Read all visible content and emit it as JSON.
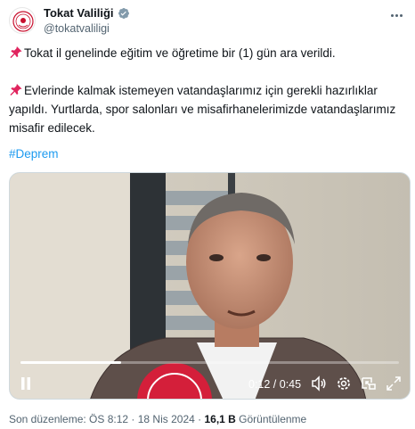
{
  "account": {
    "display_name": "Tokat Valiliği",
    "handle": "@tokatvaliligi",
    "verified_icon": "verified-badge-icon",
    "brand_color": "#c8102e"
  },
  "tweet": {
    "line1": "Tokat il genelinde eğitim ve öğretime bir (1) gün ara verildi.",
    "line2": "Evlerinde kalmak istemeyen vatandaşlarımız için gerekli hazırlıklar yapıldı. Yurtlarda, spor salonları ve misafirhanelerimizde vatandaşlarımız misafir edilecek.",
    "pin_icon": "pushpin-icon",
    "hashtag": "#Deprem",
    "link_color": "#1d9bf0"
  },
  "video": {
    "time": "0:12 / 0:45",
    "progress": 0.267,
    "icons": [
      "pause-icon",
      "volume-icon",
      "settings-icon",
      "pip-icon",
      "fullscreen-icon"
    ]
  },
  "footer": {
    "edited": "Son düzenleme: ÖS 8:12 · 18 Nis 2024 · ",
    "views_count": "16,1 B",
    "views_label": " Görüntülenme"
  }
}
